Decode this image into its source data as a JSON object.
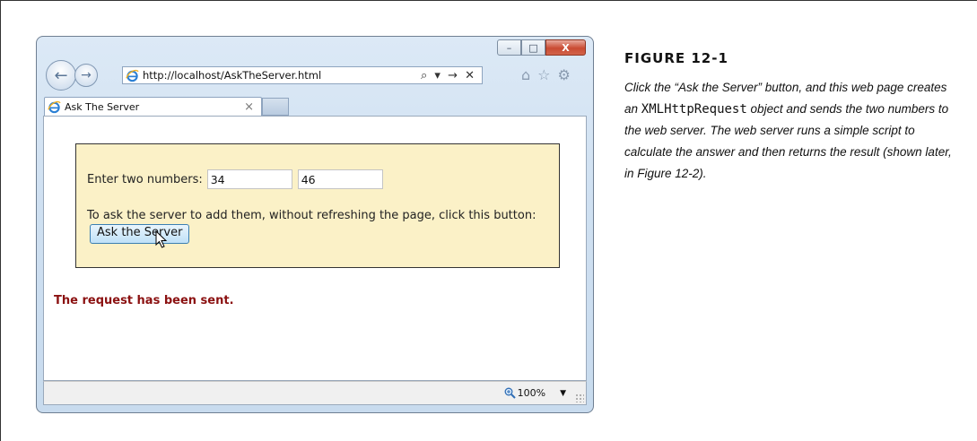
{
  "browser": {
    "address_url": "http://localhost/AskTheServer.html",
    "address_tools": "⌕ ▾ → ✕",
    "tab_title": "Ask The Server",
    "tab_close": "×",
    "status_zoom": "100%",
    "controls": {
      "minimize": "–",
      "maximize": "□",
      "close": "X"
    },
    "icons": [
      "back-arrow-icon",
      "forward-arrow-icon",
      "ie-logo-icon",
      "home-icon",
      "star-icon",
      "gear-icon",
      "zoom-icon"
    ]
  },
  "page": {
    "prompt_label": "Enter two numbers:",
    "number1": "34",
    "number2": "46",
    "instruction": "To ask the server to add them, without refreshing the page, click this button:",
    "ask_button": "Ask the Server",
    "result_message": "The request has been sent."
  },
  "caption": {
    "figure_label": "FIGURE 12-1",
    "text_before_code": "Click the “Ask the Server” button, and this web page creates an ",
    "code": "XMLHttpRequest",
    "text_after_code": " object and sends the two numbers to the web server. The web server runs a simple script to calculate the answer and then returns the result (shown later, in Figure 12-2)."
  },
  "colors": {
    "panel_background": "#fbf1c7",
    "result_text": "#8b1111",
    "button_border": "#3c7fb1",
    "close_button": "#c94b33"
  }
}
